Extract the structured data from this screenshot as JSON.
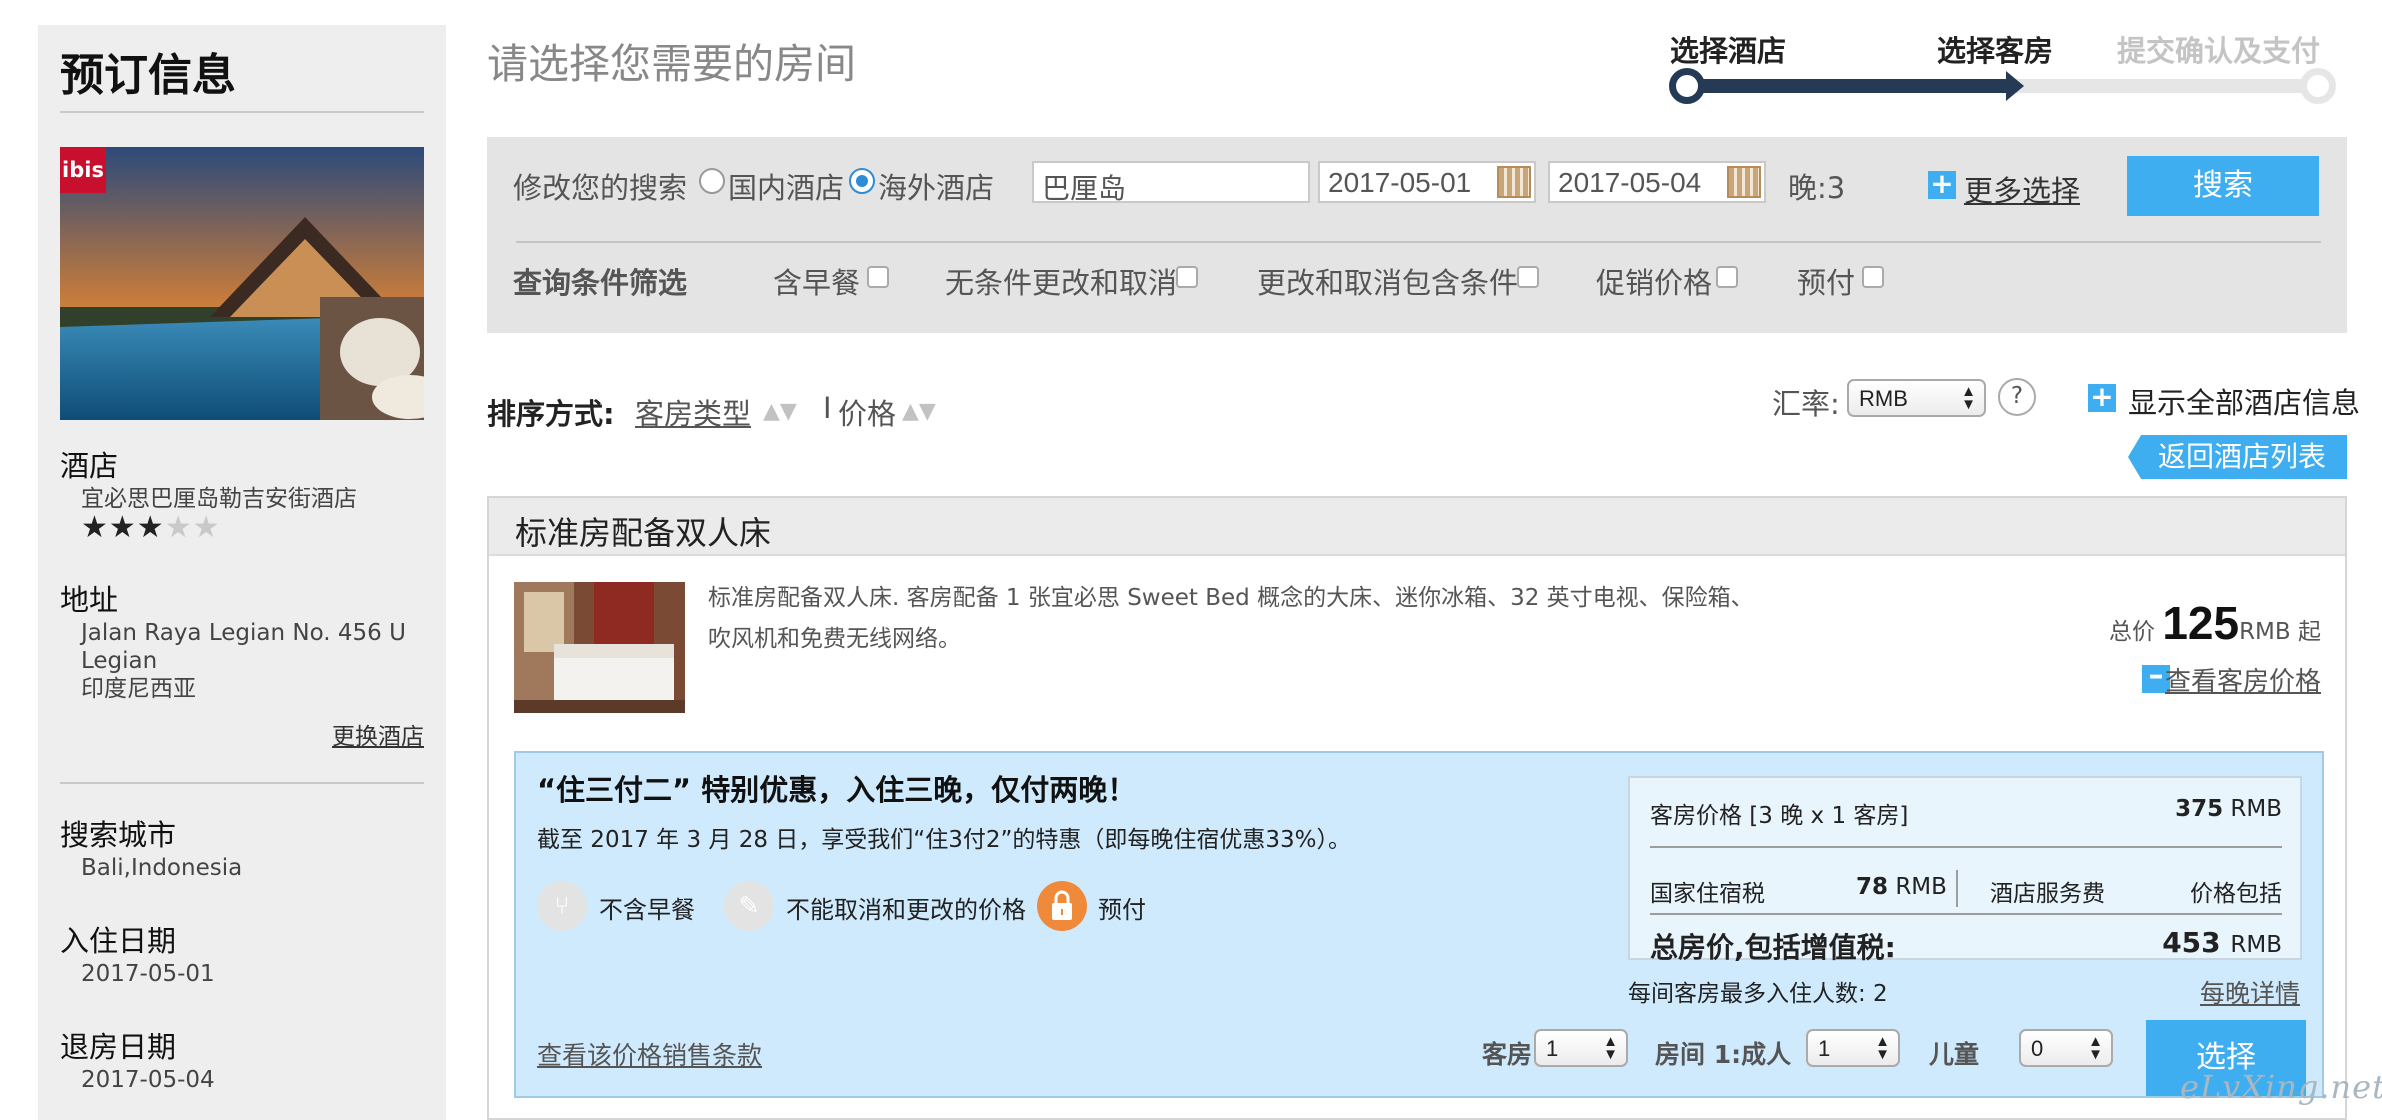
{
  "sidebar": {
    "title": "预订信息",
    "photo_badge": "ibis",
    "hotel_label": "酒店",
    "hotel_name": "宜必思巴厘岛勒吉安街酒店",
    "stars": {
      "rating": 3,
      "max": 5
    },
    "address_label": "地址",
    "address_line1": "Jalan Raya Legian No. 456 U",
    "address_line2": "Legian",
    "address_line3": "印度尼西亚",
    "change_hotel": "更换酒店",
    "city_label": "搜索城市",
    "city_value": "Bali,Indonesia",
    "checkin_label": "入住日期",
    "checkin_value": "2017-05-01",
    "checkout_label": "退房日期",
    "checkout_value": "2017-05-04"
  },
  "header": {
    "title": "请选择您需要的房间",
    "steps": [
      {
        "label": "选择酒店",
        "state": "done"
      },
      {
        "label": "选择客房",
        "state": "current"
      },
      {
        "label": "提交确认及支付",
        "state": "pending"
      }
    ]
  },
  "search": {
    "modify_label": "修改您的搜索",
    "radio_domestic": "国内酒店",
    "radio_overseas": "海外酒店",
    "selected_radio": "overseas",
    "destination": "巴厘岛",
    "checkin": "2017-05-01",
    "checkout": "2017-05-04",
    "nights": "晚:3",
    "more_options": "更多选择",
    "search_button": "搜索"
  },
  "filters": {
    "label": "查询条件筛选",
    "options": [
      "含早餐",
      "无条件更改和取消",
      "更改和取消包含条件",
      "促销价格",
      "预付"
    ]
  },
  "sort": {
    "label": "排序方式:",
    "room_type": "客房类型",
    "separator": "I",
    "price": "价格",
    "rate_label": "汇率:",
    "currency": "RMB",
    "help": "?",
    "show_all": "显示全部酒店信息",
    "back": "返回酒店列表"
  },
  "room": {
    "name": "标准房配备双人床",
    "description": "标准房配备双人床. 客房配备 1 张宜必思 Sweet Bed 概念的大床、迷你冰箱、32 英寸电视、保险箱、吹风机和免费无线网络。",
    "total_prefix": "总价",
    "total_amount": "125",
    "total_suffix": "RMB 起",
    "view_prices": "查看客房价格"
  },
  "offer": {
    "title": "“住三付二” 特别优惠，入住三晚，仅付两晚！",
    "text": "截至 2017 年 3 月 28 日，享受我们“住3付2”的特惠（即每晚住宿优惠33%）。",
    "features": [
      {
        "icon": "fork-knife-icon",
        "label": "不含早餐"
      },
      {
        "icon": "no-change-icon",
        "label": "不能取消和更改的价格"
      },
      {
        "icon": "lock-icon",
        "label": "预付"
      }
    ],
    "terms": "查看该价格销售条款",
    "price_box": {
      "room_price_label": "客房价格 [3 晚 x 1 客房]",
      "room_price_amount": "375",
      "currency": "RMB",
      "tax_label": "国家住宿税",
      "tax_amount": "78",
      "service_label": "酒店服务费",
      "service_value": "价格包括",
      "total_label": "总房价,包括增值税:",
      "total_amount": "453"
    },
    "max_occupancy": "每间客房最多入住人数: 2",
    "nightly_details": "每晚详情",
    "rooms_label": "客房",
    "rooms_value": "1",
    "adults_label": "房间 1:成人",
    "adults_value": "1",
    "children_label": "儿童",
    "children_value": "0",
    "select_button": "选择"
  },
  "watermark": "eLvXing.net",
  "colors": {
    "accent": "#3eaef0",
    "step_dark": "#243a55",
    "offer_bg": "#cfeafd",
    "sidebar_bg": "#eeeeee"
  }
}
